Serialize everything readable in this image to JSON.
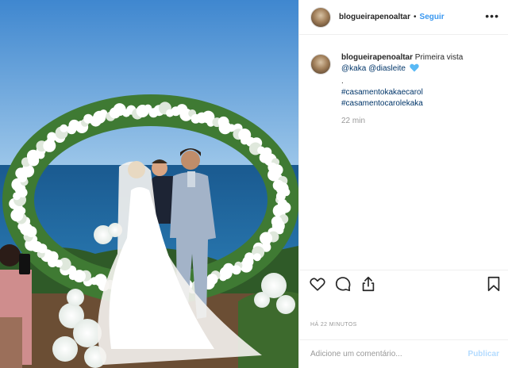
{
  "post": {
    "username": "blogueirapenoaltar",
    "separator": "•",
    "follow_label": "Seguir",
    "more_label": "•••"
  },
  "caption": {
    "username": "blogueirapenoaltar",
    "text": "Primeira vista",
    "mention1": "@kaka",
    "mention2": "@diasleite",
    "dot": ".",
    "hashtag1": "#casamentokakaecarol",
    "hashtag2": "#casamentocarolekaka",
    "time": "22 min"
  },
  "meta": {
    "ago": "HÁ 22 MINUTOS"
  },
  "comment_box": {
    "placeholder": "Adicione um comentário...",
    "post_label": "Publicar"
  },
  "icons": {
    "heart": "heart-icon",
    "comment": "comment-icon",
    "share": "share-icon",
    "bookmark": "bookmark-icon",
    "caption_heart": "blue-heart-emoji"
  },
  "colors": {
    "link": "#3897f0",
    "mention": "#003569",
    "muted": "#999999",
    "post_disabled": "#b3dbff",
    "sky": "#5b9fd6",
    "sea": "#1c5f95"
  }
}
